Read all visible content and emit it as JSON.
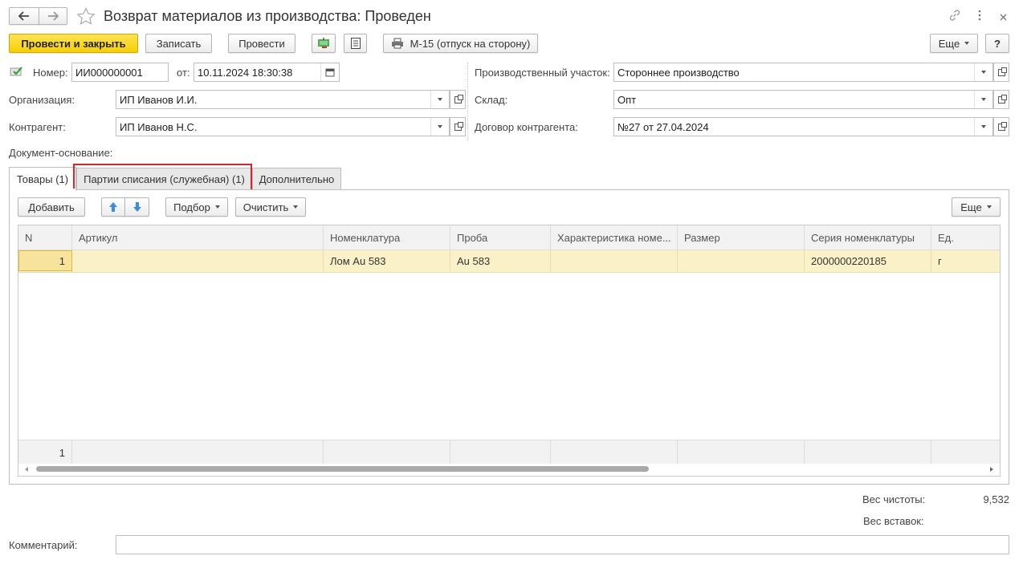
{
  "title": "Возврат материалов из производства: Проведен",
  "toolbar": {
    "post_and_close": "Провести и закрыть",
    "save": "Записать",
    "post": "Провести",
    "print_m15": "М-15 (отпуск на сторону)",
    "more": "Еще",
    "help": "?"
  },
  "header": {
    "number_label": "Номер:",
    "number_value": "ИИ000000001",
    "date_label": "от:",
    "date_value": "10.11.2024 18:30:38",
    "org_label": "Организация:",
    "org_value": "ИП Иванов И.И.",
    "contractor_label": "Контрагент:",
    "contractor_value": "ИП Иванов Н.С.",
    "basis_label": "Документ-основание:",
    "section_label": "Производственный участок:",
    "section_value": "Стороннее производство",
    "warehouse_label": "Склад:",
    "warehouse_value": "Опт",
    "contract_label": "Договор контрагента:",
    "contract_value": "№27 от 27.04.2024"
  },
  "tabs": [
    {
      "label": "Товары (1)"
    },
    {
      "label": "Партии списания (служебная) (1)"
    },
    {
      "label": "Дополнительно"
    }
  ],
  "table_toolbar": {
    "add": "Добавить",
    "pick": "Подбор",
    "clear": "Очистить",
    "more": "Еще"
  },
  "table": {
    "columns": [
      "N",
      "Артикул",
      "Номенклатура",
      "Проба",
      "Характеристика номе...",
      "Размер",
      "Серия номенклатуры",
      "Ед."
    ],
    "rows": [
      [
        "1",
        "",
        "Лом Au 583",
        "Au 583",
        "",
        "",
        "2000000220185",
        "г"
      ]
    ],
    "footer_count": "1"
  },
  "totals": {
    "purity_label": "Вес чистоты:",
    "purity_value": "9,532",
    "inserts_label": "Вес вставок:",
    "inserts_value": ""
  },
  "comment_label": "Комментарий:",
  "comment_value": "",
  "colors": {
    "accent_yellow": "#f5d000",
    "row_highlight": "#fbf1c8",
    "selected_cell": "#f7e39b",
    "tab_highlight_border": "#d9262b"
  }
}
